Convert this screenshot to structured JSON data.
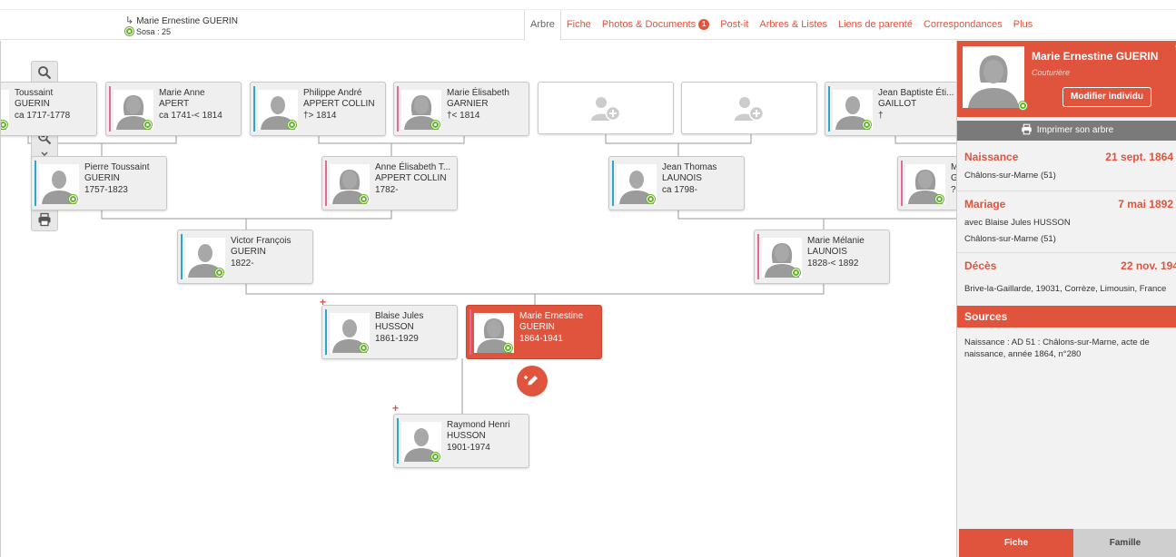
{
  "header": {
    "person_name": "Marie Ernestine GUERIN",
    "sosa_label": "Sosa : 25",
    "tabs": [
      {
        "label": "Arbre",
        "active": true
      },
      {
        "label": "Fiche"
      },
      {
        "label": "Photos & Documents",
        "badge": "1"
      },
      {
        "label": "Post-it"
      },
      {
        "label": "Arbres & Listes"
      },
      {
        "label": "Liens de parenté"
      },
      {
        "label": "Correspondances"
      },
      {
        "label": "Plus"
      }
    ]
  },
  "toolbar": {
    "icons": [
      "search-icon",
      "target-icon",
      "zoom-in-icon",
      "zoom-out-icon",
      "collapse-icon",
      "expand-icon"
    ],
    "print_icon": "print-icon"
  },
  "cards": [
    {
      "id": "c0",
      "sex": "m",
      "name1": "Toussaint",
      "name2": "GUERIN",
      "dates": "ca 1717-1778"
    },
    {
      "id": "c1",
      "sex": "f",
      "name1": "Marie Anne",
      "name2": "APERT",
      "dates": "ca 1741-< 1814"
    },
    {
      "id": "c2",
      "sex": "m",
      "name1": "Philippe André",
      "name2": "APPERT COLLIN",
      "dates": "†> 1814"
    },
    {
      "id": "c3",
      "sex": "f",
      "name1": "Marie Élisabeth",
      "name2": "GARNIER",
      "dates": "†< 1814"
    },
    {
      "id": "c6",
      "sex": "m",
      "name1": "Jean Baptiste Éti...",
      "name2": "GAILLOT",
      "dates": "†"
    },
    {
      "id": "c7",
      "sex": "m",
      "name1": "Pierre Toussaint",
      "name2": "GUERIN",
      "dates": "1757-1823"
    },
    {
      "id": "c8",
      "sex": "f",
      "name1": "Anne Élisabeth T...",
      "name2": "APPERT COLLIN",
      "dates": "1782-"
    },
    {
      "id": "c9",
      "sex": "m",
      "name1": "Jean Thomas",
      "name2": "LAUNOIS",
      "dates": "ca 1798-"
    },
    {
      "id": "c10",
      "sex": "f",
      "name1": "M",
      "name2": "G",
      "dates": "?"
    },
    {
      "id": "c11",
      "sex": "m",
      "name1": "Victor François",
      "name2": "GUERIN",
      "dates": "1822-"
    },
    {
      "id": "c12",
      "sex": "f",
      "name1": "Marie Mélanie",
      "name2": "LAUNOIS",
      "dates": "1828-< 1892"
    },
    {
      "id": "c13",
      "sex": "m",
      "name1": "Blaise Jules",
      "name2": "HUSSON",
      "dates": "1861-1929"
    },
    {
      "id": "c14",
      "sex": "f",
      "name1": "Marie Ernestine",
      "name2": "GUERIN",
      "dates": "1864-1941",
      "selected": true
    },
    {
      "id": "c15",
      "sex": "m",
      "name1": "Raymond Henri",
      "name2": "HUSSON",
      "dates": "1901-1974"
    }
  ],
  "panel": {
    "name": "Marie Ernestine GUERIN",
    "occupation": "Couturière",
    "edit_label": "Modifier individu",
    "print_label": "Imprimer son arbre",
    "birth": {
      "label": "Naissance",
      "date": "21 sept. 1864",
      "place": "Châlons-sur-Marne (51)"
    },
    "marriage": {
      "label": "Mariage",
      "date": "7 mai 1892",
      "spouse": "avec Blaise Jules HUSSON",
      "place": "Châlons-sur-Marne (51)"
    },
    "death": {
      "label": "Décès",
      "date": "22 nov. 194",
      "place": "Brive-la-Gaillarde, 19031, Corrèze, Limousin, France"
    },
    "sources_label": "Sources",
    "sources_text": "Naissance : AD 51 : Châlons-sur-Marne, acte de naissance, année 1864, n°280",
    "tab_fiche": "Fiche",
    "tab_famille": "Famille"
  },
  "colors": {
    "accent": "#e0533d",
    "male": "#2ba7c9",
    "female": "#e26a9a",
    "sosa": "#69b32d"
  }
}
